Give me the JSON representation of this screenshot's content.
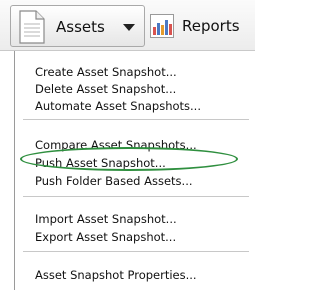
{
  "toolbar": {
    "assets_label": "Assets",
    "reports_label": "Reports",
    "icons": {
      "assets": "document-icon",
      "assets_dropdown": "caret-down-icon",
      "reports": "bar-chart-icon"
    }
  },
  "menu": {
    "groups": [
      [
        "Create Asset Snapshot...",
        "Delete Asset Snapshot...",
        "Automate Asset Snapshots..."
      ],
      [
        "Compare Asset Snapshots...",
        "Push Asset Snapshot...",
        "Push Folder Based Assets..."
      ],
      [
        "Import Asset Snapshot...",
        "Export Asset Snapshot..."
      ],
      [
        "Asset Snapshot Properties..."
      ]
    ],
    "items": {
      "create": "Create Asset Snapshot...",
      "delete": "Delete Asset Snapshot...",
      "automate": "Automate Asset Snapshots...",
      "compare": "Compare Asset Snapshots...",
      "push": "Push Asset Snapshot...",
      "push_folder": "Push Folder Based Assets...",
      "import": "Import Asset Snapshot...",
      "export": "Export Asset Snapshot...",
      "properties": "Asset Snapshot Properties..."
    },
    "highlighted_item": "Push Folder Based Assets...",
    "highlight_color": "#2f8f3f"
  }
}
